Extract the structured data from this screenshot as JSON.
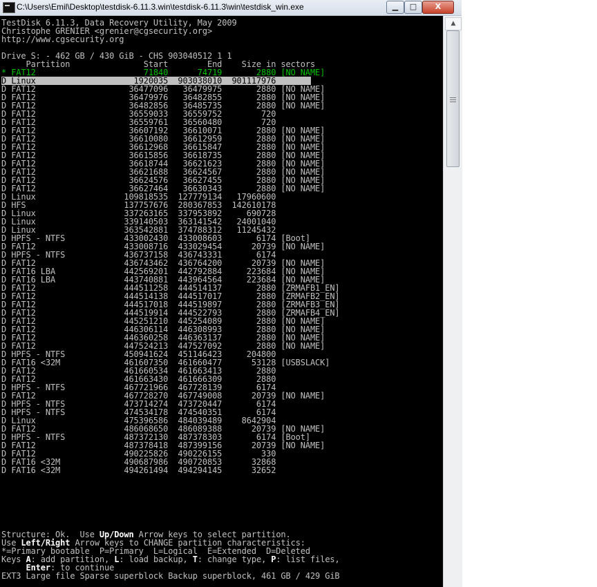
{
  "window": {
    "title": "C:\\Users\\Emil\\Desktop\\testdisk-6.11.3.win\\testdisk-6.11.3\\win\\testdisk_win.exe",
    "minimize_glyph": "▁",
    "maximize_glyph": "□",
    "close_glyph": "X"
  },
  "header": [
    "TestDisk 6.11.3, Data Recovery Utility, May 2009",
    "Christophe GRENIER <grenier@cgsecurity.org>",
    "http://www.cgsecurity.org",
    "",
    "Drive S: - 462 GB / 430 GiB - CHS 903040512 1 1",
    "     Partition               Start        End    Size in sectors"
  ],
  "partitions": [
    "* FAT12                      71840      74719       2880 [NO NAME]",
    "D Linux                    1920035  903038010  901117976",
    "D FAT12                   36477096   36479975       2880 [NO NAME]",
    "D FAT12                   36479976   36482855       2880 [NO NAME]",
    "D FAT12                   36482856   36485735       2880 [NO NAME]",
    "D FAT12                   36559033   36559752        720",
    "D FAT12                   36559761   36560480        720",
    "D FAT12                   36607192   36610071       2880 [NO NAME]",
    "D FAT12                   36610080   36612959       2880 [NO NAME]",
    "D FAT12                   36612968   36615847       2880 [NO NAME]",
    "D FAT12                   36615856   36618735       2880 [NO NAME]",
    "D FAT12                   36618744   36621623       2880 [NO NAME]",
    "D FAT12                   36621688   36624567       2880 [NO NAME]",
    "D FAT12                   36624576   36627455       2880 [NO NAME]",
    "D FAT12                   36627464   36630343       2880 [NO NAME]",
    "D Linux                  109818535  127779134   17960600",
    "D HFS                    137757676  280367853  142610178",
    "D Linux                  337263165  337953892     690728",
    "D Linux                  339140503  363141542   24001040",
    "D Linux                  363542881  374788312   11245432",
    "D HPFS - NTFS            433002430  433008603       6174 [Boot]",
    "D FAT12                  433008716  433029454      20739 [NO NAME]",
    "D HPFS - NTFS            436737158  436743331       6174",
    "D FAT12                  436743462  436764200      20739 [NO NAME]",
    "D FAT16 LBA              442569201  442792884     223684 [NO NAME]",
    "D FAT16 LBA              443740881  443964564     223684 [NO NAME]",
    "D FAT12                  444511258  444514137       2880 [ZRMAFB1_EN]",
    "D FAT12                  444514138  444517017       2880 [ZRMAFB2_EN]",
    "D FAT12                  444517018  444519897       2880 [ZRMAFB3_EN]",
    "D FAT12                  444519914  444522793       2880 [ZRMAFB4_EN]",
    "D FAT12                  445251210  445254089       2880 [NO NAME]",
    "D FAT12                  446306114  446308993       2880 [NO NAME]",
    "D FAT12                  446360258  446363137       2880 [NO NAME]",
    "D FAT12                  447524213  447527092       2880 [NO NAME]",
    "D HPFS - NTFS            450941624  451146423     204800",
    "D FAT16 <32M             461607350  461660477      53128 [USBSLACK]",
    "D FAT12                  461660534  461663413       2880",
    "D FAT12                  461663430  461666309       2880",
    "D HPFS - NTFS            467721966  467728139       6174",
    "D FAT12                  467728270  467749008      20739 [NO NAME]",
    "D HPFS - NTFS            473714274  473720447       6174",
    "D HPFS - NTFS            474534178  474540351       6174",
    "D Linux                  475396586  484039489    8642904",
    "D FAT12                  486068650  486089388      20739 [NO NAME]",
    "D HPFS - NTFS            487372130  487378303       6174 [Boot]",
    "D FAT12                  487378418  487399156      20739 [NO NAME]",
    "D FAT12                  490225826  490226155        330",
    "D FAT16 <32M             490687986  490720853      32868",
    "D FAT16 <32M             494261494  494294145      32652"
  ],
  "selected_index": 1,
  "footer": {
    "l1_a": "Structure: Ok.  Use ",
    "l1_key": "Up/Down",
    "l1_b": " Arrow keys to select partition.",
    "l2_a": "Use ",
    "l2_key": "Left/Right",
    "l2_b": " Arrow keys to CHANGE partition characteristics:",
    "l3": "*=Primary bootable  P=Primary  L=Logical  E=Extended  D=Deleted",
    "l4_a": "Keys ",
    "l4_k1": "A",
    "l4_b": ": add partition, ",
    "l4_k2": "L",
    "l4_c": ": load backup, ",
    "l4_k3": "T",
    "l4_d": ": change type, ",
    "l4_k4": "P",
    "l4_e": ": list files,",
    "l5_a": "     ",
    "l5_key": "Enter",
    "l5_b": ": to continue",
    "l6": "EXT3 Large file Sparse superblock Backup superblock, 461 GB / 429 GiB"
  },
  "scrollbar": {
    "up_glyph": "▲"
  },
  "colors": {
    "console_bg": "#000000",
    "text": "#c0c0c0",
    "bootable_green": "#00c000",
    "selection_bg": "#c0c0c0"
  }
}
